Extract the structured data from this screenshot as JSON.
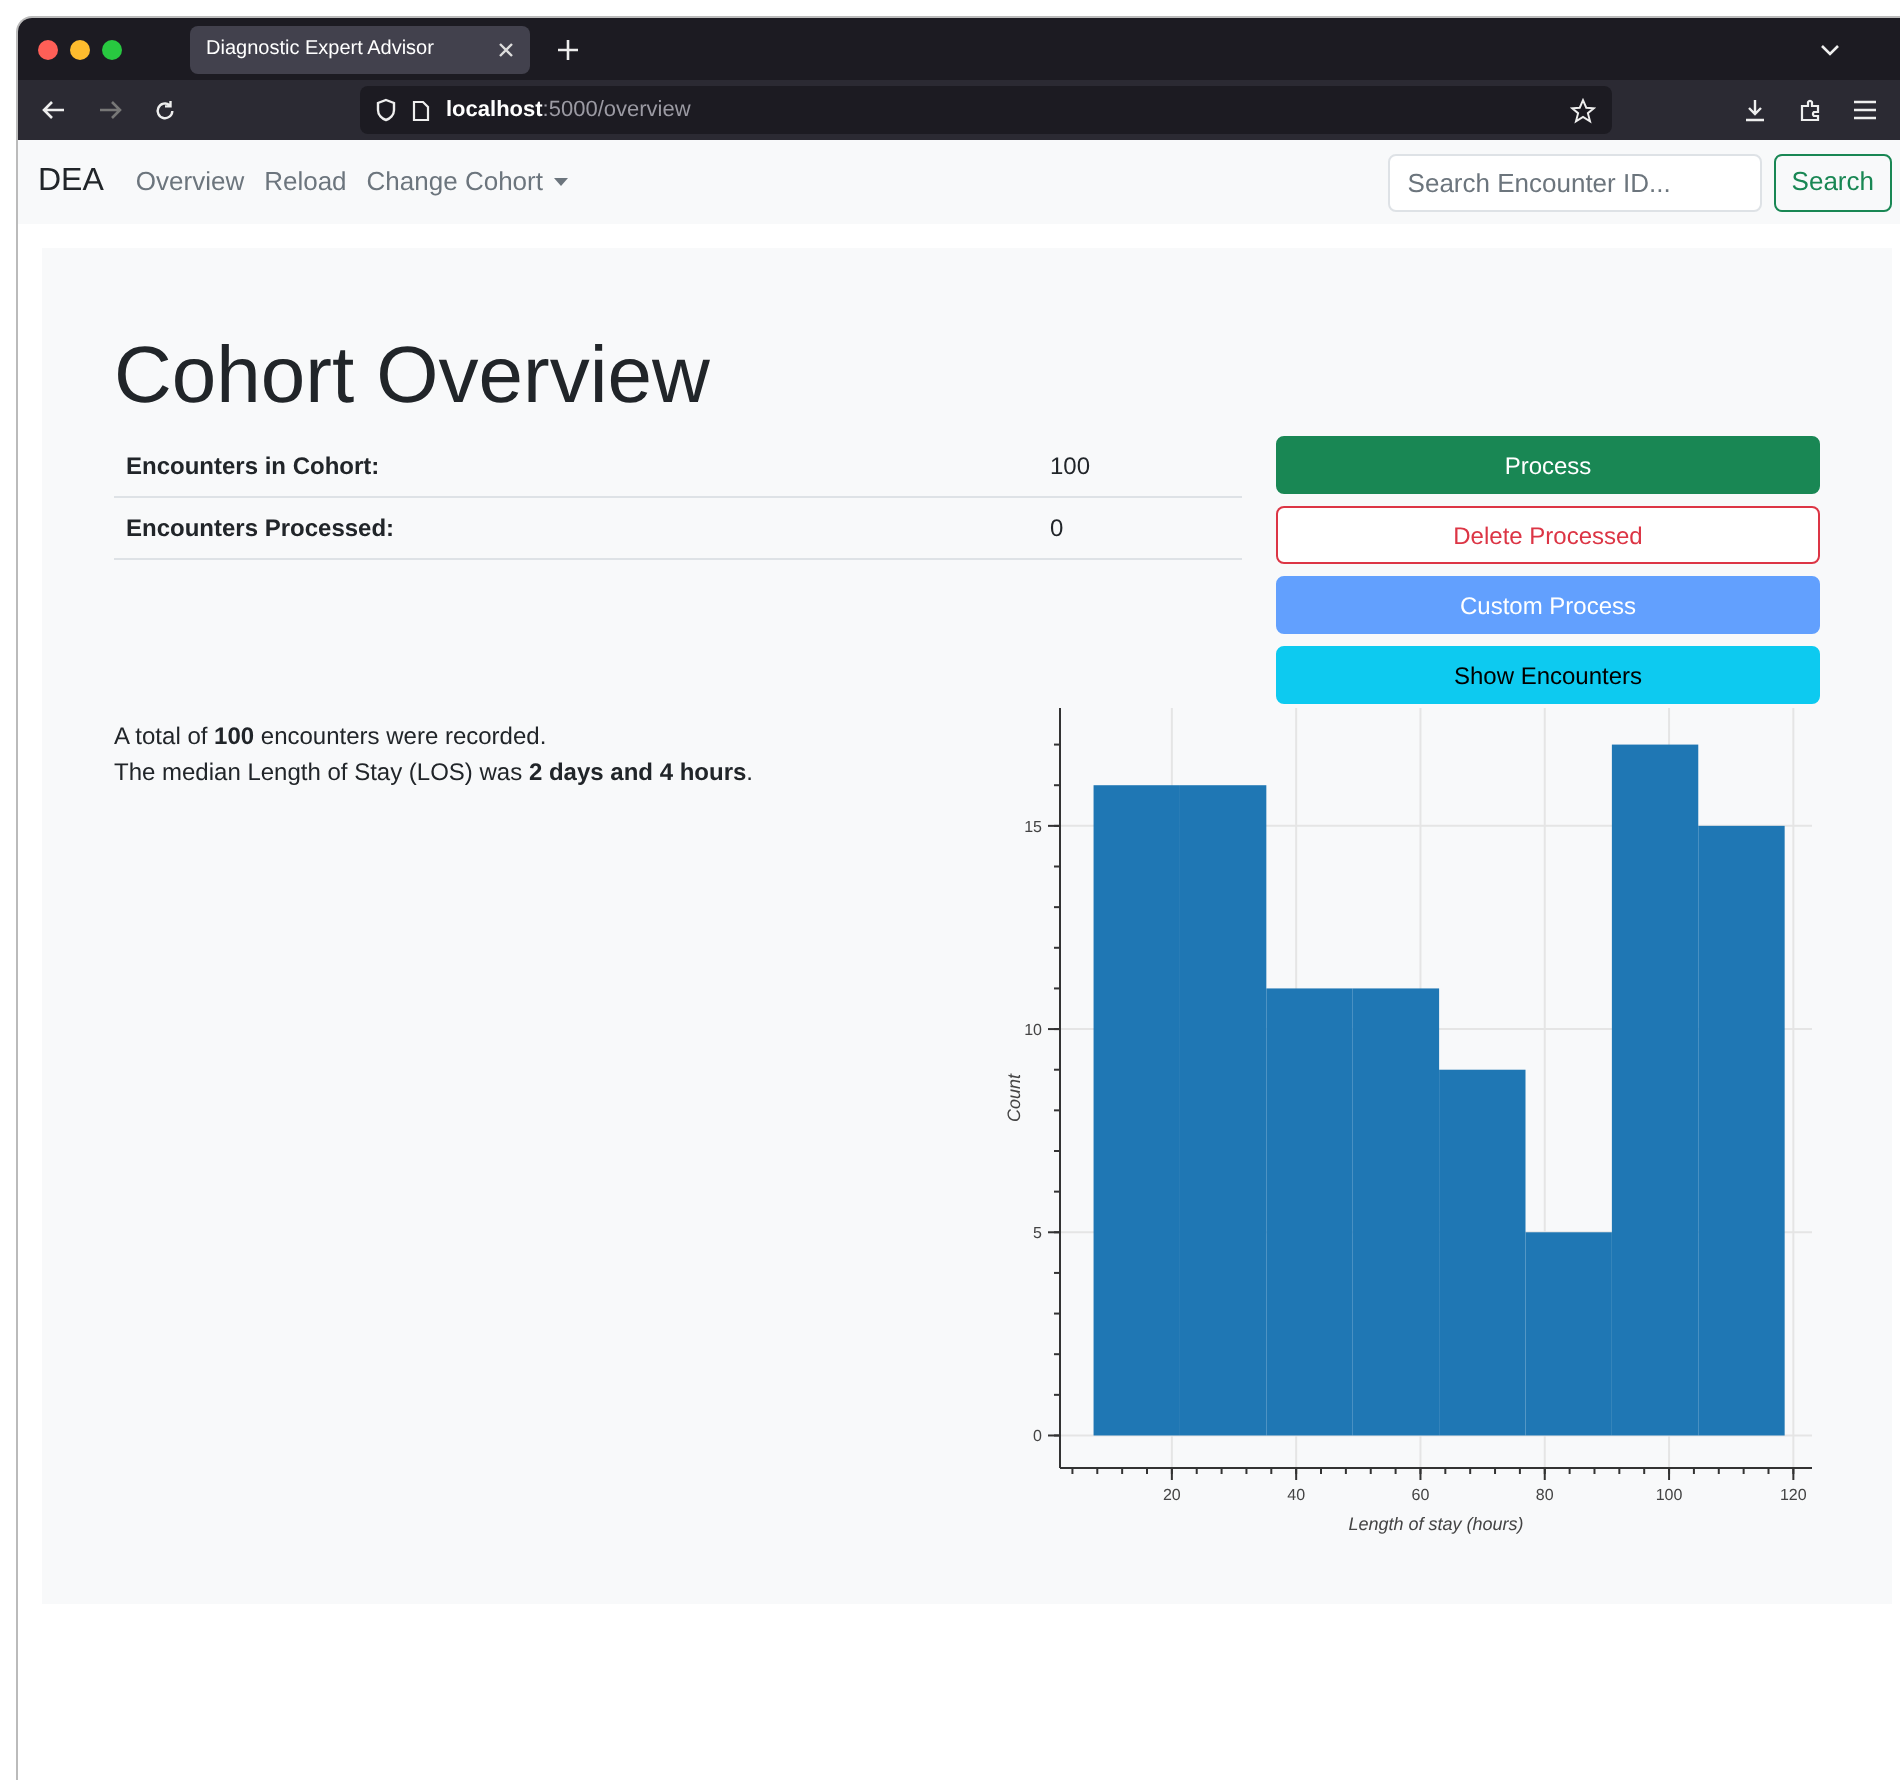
{
  "browser": {
    "tab_title": "Diagnostic Expert Advisor",
    "url_host": "localhost",
    "url_path": ":5000/overview",
    "forward_disabled": true
  },
  "navbar": {
    "brand": "DEA",
    "links": [
      {
        "label": "Overview",
        "dropdown": false
      },
      {
        "label": "Reload",
        "dropdown": false
      },
      {
        "label": "Change Cohort",
        "dropdown": true
      }
    ],
    "search": {
      "placeholder": "Search Encounter ID..."
    },
    "search_button": "Search"
  },
  "page": {
    "title": "Cohort Overview",
    "stats": [
      {
        "label": "Encounters in Cohort:",
        "value": "100"
      },
      {
        "label": "Encounters Processed:",
        "value": "0"
      }
    ],
    "buttons": [
      {
        "label": "Process",
        "kind": "success"
      },
      {
        "label": "Delete Processed",
        "kind": "outline-danger"
      },
      {
        "label": "Custom Process",
        "kind": "primary-light"
      },
      {
        "label": "Show Encounters",
        "kind": "info"
      }
    ],
    "summary": [
      "A total of **100** encounters were recorded.",
      "The median Length of Stay (LOS) was **2 days and 4 hours**."
    ],
    "chart_data": {
      "type": "bar",
      "xlabel": "Length of stay (hours)",
      "ylabel": "Count",
      "x": [
        14.35,
        28.25,
        42.15,
        56.05,
        69.95,
        83.85,
        97.75,
        111.65
      ],
      "grid": true,
      "series": [
        {
          "color": "#1f77b4",
          "values": [
            16,
            16,
            11,
            11,
            9,
            5,
            17,
            15
          ]
        }
      ],
      "xlim": [
        2,
        123
      ],
      "ylim": [
        -0.8,
        17.9
      ],
      "xticks": [
        20,
        40,
        60,
        80,
        100,
        120
      ],
      "yticks": [
        0,
        5,
        10,
        15
      ]
    }
  }
}
